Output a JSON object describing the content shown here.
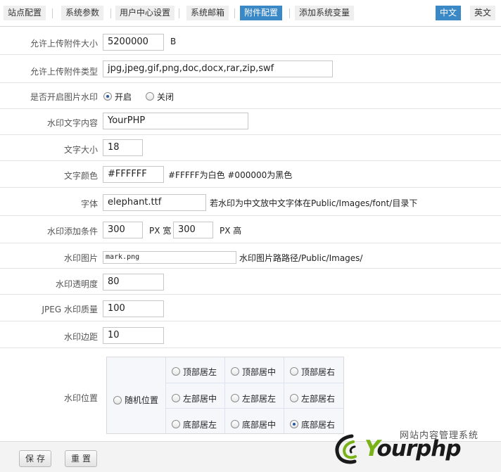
{
  "tabs": [
    {
      "label": "站点配置",
      "active": false
    },
    {
      "label": "系统参数",
      "active": false
    },
    {
      "label": "用户中心设置",
      "active": false
    },
    {
      "label": "系统邮箱",
      "active": false
    },
    {
      "label": "附件配置",
      "active": true
    },
    {
      "label": "添加系统变量",
      "active": false
    }
  ],
  "lang": {
    "zh": "中文",
    "en": "英文"
  },
  "colors": {
    "accent": "#3b88c6",
    "logo_green": "#7ab317"
  },
  "form": {
    "max_size": {
      "label": "允许上传附件大小",
      "value": "5200000",
      "unit": "B"
    },
    "types": {
      "label": "允许上传附件类型",
      "value": "jpg,jpeg,gif,png,doc,docx,rar,zip,swf"
    },
    "watermark_enable": {
      "label": "是否开启图片水印",
      "on": "开启",
      "off": "关闭",
      "selected": "on"
    },
    "wm_text": {
      "label": "水印文字内容",
      "value": "YourPHP"
    },
    "font_size": {
      "label": "文字大小",
      "value": "18"
    },
    "font_color": {
      "label": "文字颜色",
      "value": "#FFFFFF",
      "note": "#FFFFF为白色 #000000为黑色"
    },
    "font_file": {
      "label": "字体",
      "value": "elephant.ttf",
      "note": "若水印为中文放中文字体在Public/Images/font/目录下"
    },
    "condition": {
      "label": "水印添加条件",
      "width": "300",
      "w_unit": "PX 宽",
      "height": "300",
      "h_unit": "PX 高"
    },
    "wm_image": {
      "label": "水印图片",
      "value": "mark.png",
      "note": "水印图片路路径/Public/Images/"
    },
    "opacity": {
      "label": "水印透明度",
      "value": "80"
    },
    "jpeg_quality": {
      "label": "JPEG 水印质量",
      "value": "100"
    },
    "margin": {
      "label": "水印边距",
      "value": "10"
    },
    "position": {
      "label": "水印位置",
      "random": "随机位置",
      "options": [
        [
          "顶部居左",
          "顶部居中",
          "顶部居右"
        ],
        [
          "左部居中",
          "左部居左",
          "左部居右"
        ],
        [
          "底部居左",
          "底部居中",
          "底部居右"
        ]
      ],
      "selected": "底部居右"
    }
  },
  "buttons": {
    "save": "保存",
    "reset": "重置"
  },
  "logo": {
    "tagline": "网站内容管理系统",
    "word_y": "Y",
    "word_rest": "ourphp"
  }
}
